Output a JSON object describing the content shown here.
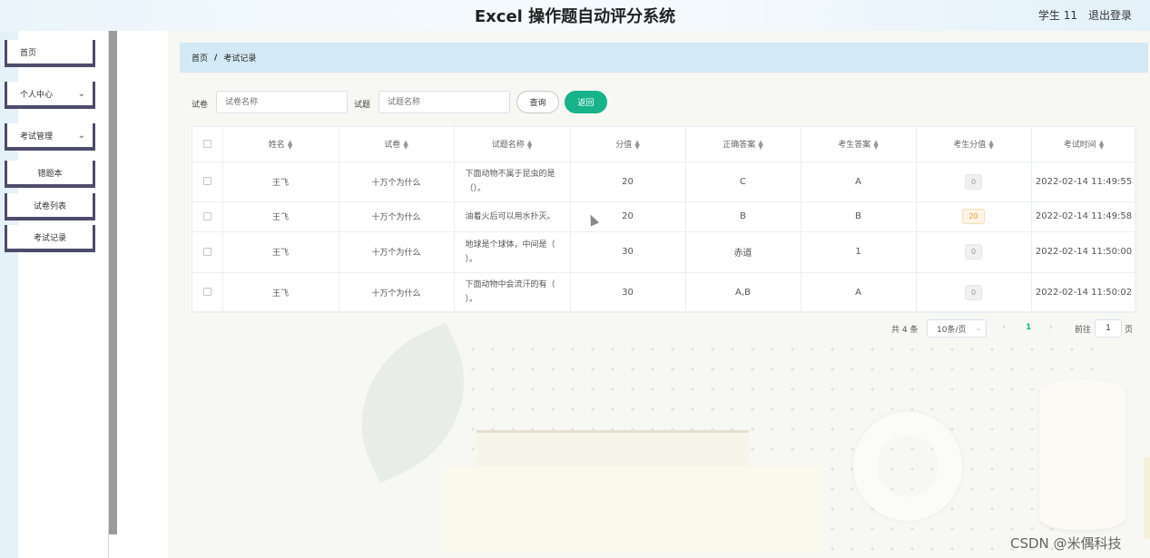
{
  "header": {
    "title": "Excel 操作题自动评分系统",
    "user": "学生 11",
    "logout": "退出登录"
  },
  "sidebar": {
    "items": [
      {
        "label": "首页"
      },
      {
        "label": "个人中心",
        "chevron": "chevron-down-icon"
      },
      {
        "label": "考试管理",
        "chevron": "chevron-down-icon"
      },
      {
        "label": "错题本"
      },
      {
        "label": "试卷列表"
      },
      {
        "label": "考试记录"
      }
    ]
  },
  "breadcrumb": {
    "home": "首页",
    "sep": "/",
    "current": "考试记录"
  },
  "search": {
    "paper_label": "试卷",
    "paper_placeholder": "试卷名称",
    "question_label": "试题",
    "question_placeholder": "试题名称",
    "query_button": "查询",
    "back_button": "返回"
  },
  "table": {
    "columns": [
      "姓名",
      "试卷",
      "试题名称",
      "分值",
      "正确答案",
      "考生答案",
      "考生分值",
      "考试时间"
    ],
    "rows": [
      {
        "name": "王飞",
        "paper": "十万个为什么",
        "question": "下面动物不属于昆虫的是（）。",
        "score": "20",
        "correct": "C",
        "answer": "A",
        "student_score": "0",
        "time": "2022-02-14 11:49:55"
      },
      {
        "name": "王飞",
        "paper": "十万个为什么",
        "question": "油着火后可以用水扑灭。",
        "score": "20",
        "correct": "B",
        "answer": "B",
        "student_score": "20",
        "time": "2022-02-14 11:49:58"
      },
      {
        "name": "王飞",
        "paper": "十万个为什么",
        "question": "地球是个球体，中间是（ ）。",
        "score": "30",
        "correct": "赤道",
        "answer": "1",
        "student_score": "0",
        "time": "2022-02-14 11:50:00"
      },
      {
        "name": "王飞",
        "paper": "十万个为什么",
        "question": "下面动物中会流汗的有（ ）。",
        "score": "30",
        "correct": "A,B",
        "answer": "A",
        "student_score": "0",
        "time": "2022-02-14 11:50:02"
      }
    ]
  },
  "pagination": {
    "total": "共 4 条",
    "page_size": "10条/页",
    "prev": "‹",
    "current": "1",
    "next": "›",
    "goto": "前往",
    "goto_value": "1",
    "unit": "页"
  },
  "watermark": "CSDN @米偶科技",
  "colors": {
    "accent": "#19b38b",
    "breadcrumb_bg": "#d3eaf6",
    "sidebar_border": "#4f4b6b",
    "warn_tag": "#e6a23c"
  }
}
